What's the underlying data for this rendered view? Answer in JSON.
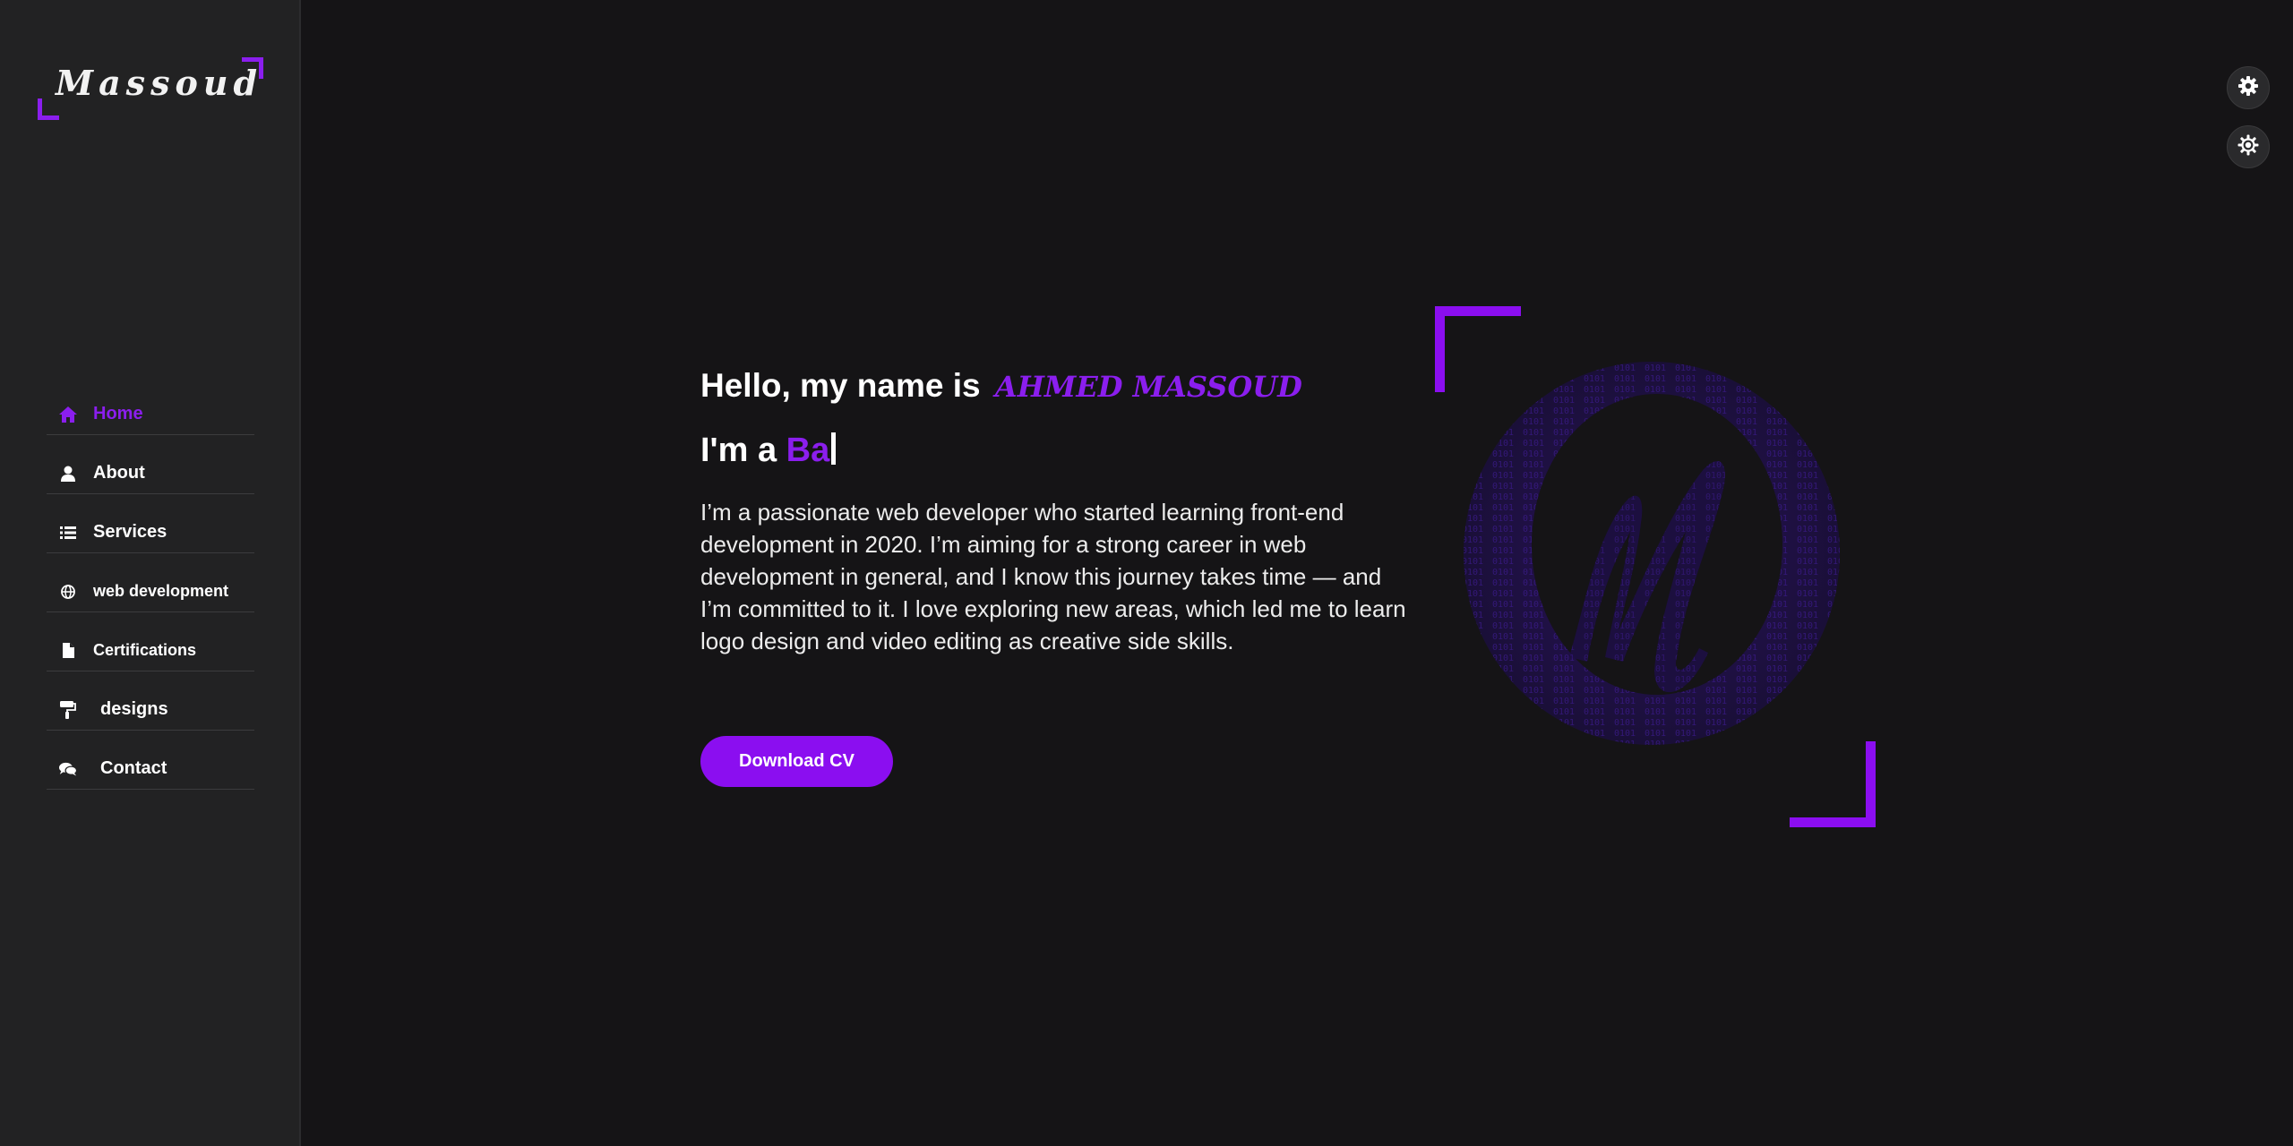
{
  "brand": {
    "logo_text": "Massoud"
  },
  "nav": [
    {
      "label": "Home",
      "icon": "home-icon",
      "active": true
    },
    {
      "label": "About",
      "icon": "user-icon"
    },
    {
      "label": "Services",
      "icon": "list-icon"
    },
    {
      "label": "web development",
      "icon": "globe-icon"
    },
    {
      "label": "Certifications",
      "icon": "file-icon"
    },
    {
      "label": "designs",
      "icon": "paint-roller-icon"
    },
    {
      "label": "Contact",
      "icon": "comments-icon"
    }
  ],
  "hero": {
    "greeting": "Hello, my name is",
    "name": "AHMED MASSOUD",
    "role_prefix": "I'm a",
    "role_typed": "Ba",
    "bio": "I’m a passionate web developer who started learning front-end development in 2020. I’m aiming for a strong career in web development in general, and I know this journey takes time — and I’m committed to it. I love exploring new areas, which led me to learn logo design and video editing as creative side skills.",
    "cta_label": "Download CV"
  },
  "colors": {
    "accent": "#8b0ef0",
    "background": "#151416",
    "sidebar": "#222223"
  },
  "corner_buttons": [
    "gear-icon",
    "sun-icon"
  ]
}
